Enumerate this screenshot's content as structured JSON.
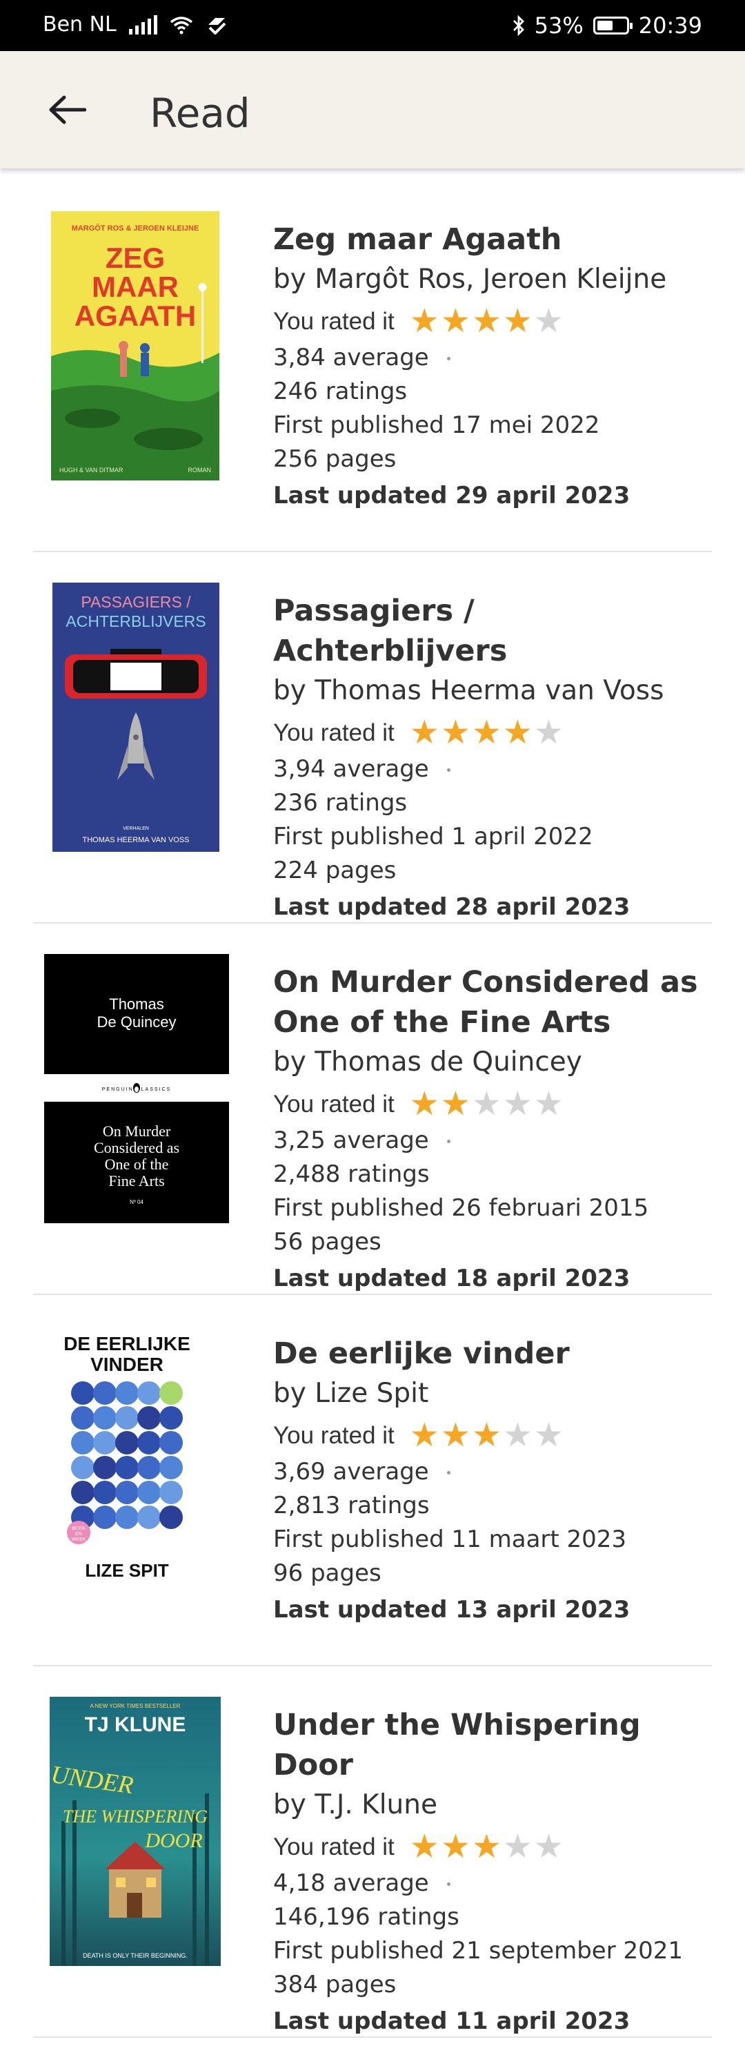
{
  "status_bar": {
    "carrier": "Ben NL",
    "battery": "53%",
    "time": "20:39"
  },
  "header": {
    "title": "Read",
    "background": "#f4f1ea"
  },
  "colors": {
    "star_on": "#f5a623",
    "star_off": "#d3d3d3"
  },
  "books": [
    {
      "title": "Zeg maar Agaath",
      "author": "by Margôt Ros, Jeroen Kleijne",
      "rated_label": "You rated it",
      "rating": 4,
      "average": "3,84 average",
      "ratings": "246 ratings",
      "first_published": "First published 17 mei 2022",
      "pages": "256 pages",
      "last_updated": "Last updated 29 april 2023",
      "cover": {
        "top_text": "MARGÔT ROS & JEROEN KLEIJNE",
        "title_lines": [
          "ZEG",
          "MAAR",
          "AGAATH"
        ],
        "bottom_left": "HUGH & VAN DITMAR",
        "bottom_right": "ROMAN"
      }
    },
    {
      "title": "Passagiers / Achterblijvers",
      "author": "by Thomas Heerma van Voss",
      "rated_label": "You rated it",
      "rating": 4,
      "average": "3,94 average",
      "ratings": "236 ratings",
      "first_published": "First published 1 april 2022",
      "pages": "224 pages",
      "last_updated": "Last updated 28 april 2023",
      "cover": {
        "title_lines": [
          "PASSAGIERS /",
          "ACHTERBLIJVERS"
        ],
        "small": "VERHALEN",
        "author": "THOMAS HEERMA VAN VOSS"
      }
    },
    {
      "title": "On Murder Considered as One of the Fine Arts",
      "author": "by Thomas de Quincey",
      "rated_label": "You rated it",
      "rating": 2,
      "average": "3,25 average",
      "ratings": "2,488 ratings",
      "first_published": "First published 26 februari 2015",
      "pages": "56 pages",
      "last_updated": "Last updated 18 april 2023",
      "cover": {
        "author_lines": [
          "Thomas",
          "De Quincey"
        ],
        "band": "PENGUIN  CLASSICS",
        "title_lines": [
          "On Murder",
          "Considered as",
          "One of the",
          "Fine Arts"
        ],
        "number": "Nº 04"
      }
    },
    {
      "title": "De eerlijke vinder",
      "author": "by Lize Spit",
      "rated_label": "You rated it",
      "rating": 3,
      "average": "3,69 average",
      "ratings": "2,813 ratings",
      "first_published": "First published 11 maart 2023",
      "pages": "96 pages",
      "last_updated": "Last updated 13 april 2023",
      "cover": {
        "title_lines": [
          "DE EERLIJKE",
          "VINDER"
        ],
        "author": "LIZE SPIT",
        "badge": [
          "BOEK",
          "EN",
          "WEEK"
        ]
      }
    },
    {
      "title": "Under the Whispering Door",
      "author": "by T.J. Klune",
      "rated_label": "You rated it",
      "rating": 3,
      "average": "4,18 average",
      "ratings": "146,196 ratings",
      "first_published": "First published 21 september 2021",
      "pages": "384 pages",
      "last_updated": "Last updated 11 april 2023",
      "cover": {
        "top": "A NEW YORK TIMES BESTSELLER",
        "author": "TJ KLUNE",
        "title_lines": [
          "UNDER",
          "THE WHISPERING",
          "DOOR"
        ],
        "tagline": "DEATH IS ONLY THEIR BEGINNING."
      }
    }
  ]
}
